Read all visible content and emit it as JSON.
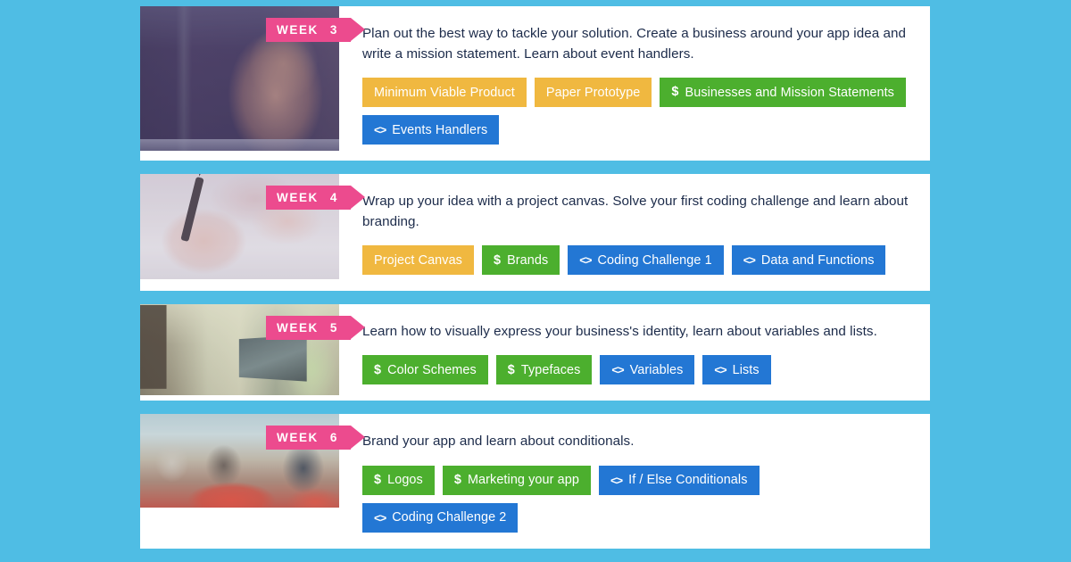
{
  "theme": {
    "page_background": "#4fbde4",
    "card_background": "#ffffff",
    "badge_color": "#ec4b8e",
    "text_color": "#1c2b4a",
    "tag_amber": "#f0b840",
    "tag_green": "#4caf2e",
    "tag_blue": "#2377d4"
  },
  "timeline": {
    "weeks": [
      {
        "badge_label": "WEEK",
        "badge_number": "3",
        "thumbnail_alt": "smiling-woman-at-computer",
        "description": "Plan out the best way to tackle your solution. Create a business around your app idea and write a mission statement. Learn about event handlers.",
        "tags": [
          {
            "label": "Minimum Viable Product",
            "color": "amber",
            "icon": ""
          },
          {
            "label": "Paper Prototype",
            "color": "amber",
            "icon": ""
          },
          {
            "label": "Businesses and Mission Statements",
            "color": "green",
            "icon": "$"
          },
          {
            "label": "Events Handlers",
            "color": "blue",
            "icon": "<>"
          }
        ]
      },
      {
        "badge_label": "WEEK",
        "badge_number": "4",
        "thumbnail_alt": "hand-writing-with-pen",
        "description": "Wrap up your idea with a project canvas. Solve your first coding challenge and learn about branding.",
        "tags": [
          {
            "label": "Project Canvas",
            "color": "amber",
            "icon": ""
          },
          {
            "label": "Brands",
            "color": "green",
            "icon": "$"
          },
          {
            "label": "Coding Challenge 1",
            "color": "blue",
            "icon": "<>"
          },
          {
            "label": "Data and Functions",
            "color": "blue",
            "icon": "<>"
          }
        ]
      },
      {
        "badge_label": "WEEK",
        "badge_number": "5",
        "thumbnail_alt": "people-working-on-laptops",
        "description": "Learn how to visually express your business's identity, learn about variables and lists.",
        "tags": [
          {
            "label": "Color Schemes",
            "color": "green",
            "icon": "$"
          },
          {
            "label": "Typefaces",
            "color": "green",
            "icon": "$"
          },
          {
            "label": "Variables",
            "color": "blue",
            "icon": "<>"
          },
          {
            "label": "Lists",
            "color": "blue",
            "icon": "<>"
          }
        ]
      },
      {
        "badge_label": "WEEK",
        "badge_number": "6",
        "thumbnail_alt": "group-sitting-on-beanbags",
        "description": "Brand your app and learn about conditionals.",
        "tags": [
          {
            "label": "Logos",
            "color": "green",
            "icon": "$"
          },
          {
            "label": "Marketing your app",
            "color": "green",
            "icon": "$"
          },
          {
            "label": "If / Else Conditionals",
            "color": "blue",
            "icon": "<>"
          },
          {
            "label": "Coding Challenge 2",
            "color": "blue",
            "icon": "<>"
          }
        ]
      }
    ]
  }
}
